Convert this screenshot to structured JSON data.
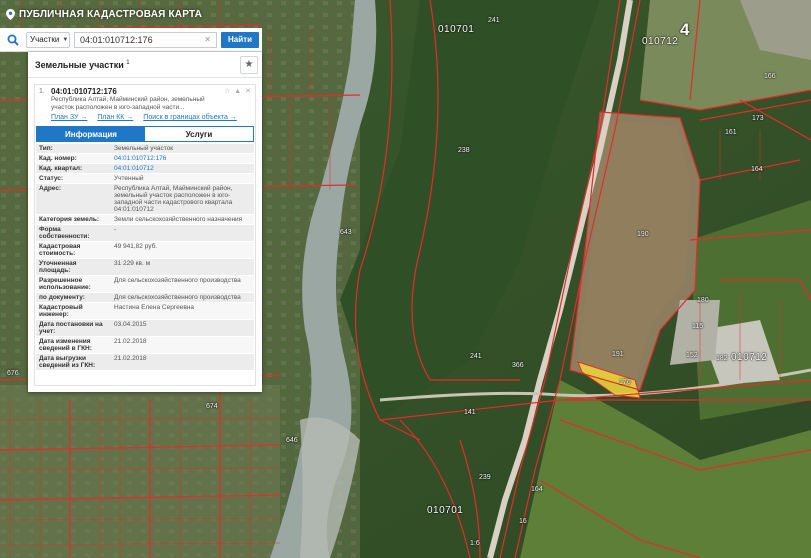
{
  "app": {
    "title": "ПУБЛИЧНАЯ КАДАСТРОВАЯ КАРТА"
  },
  "search": {
    "type": "Участки",
    "query": "04:01:010712:176",
    "clear": "✕",
    "button": "Найти"
  },
  "panel": {
    "title": "Земельные участки",
    "count": "1",
    "card": {
      "index": "1.",
      "cadastral_number": "04:01:010712:176",
      "description": "Республика Алтай, Майминский район, земельный участок расположен в юго-западной части...",
      "tools": "☆ ▲ ✕",
      "links": [
        "План ЗУ →",
        "План КК →",
        "Поиск в границах объекта →"
      ],
      "tabs": [
        "Информация",
        "Услуги"
      ],
      "rows": [
        {
          "key": "Тип:",
          "value": "Земельный участок"
        },
        {
          "key": "Кад. номер:",
          "value": "04:01:010712:176",
          "link": true
        },
        {
          "key": "Кад. квартал:",
          "value": "04:01:010712",
          "link": true
        },
        {
          "key": "Статус:",
          "value": "Учтенный"
        },
        {
          "key": "Адрес:",
          "value": "Республика Алтай, Майминский район, земельный участок расположен в юго-западной части кадастрового квартала 04:01:010712"
        },
        {
          "key": "Категория земель:",
          "value": "Земли сельскохозяйственного назначения"
        },
        {
          "key": "Форма собственности:",
          "value": "-"
        },
        {
          "key": "Кадастровая стоимость:",
          "value": "49 941,82 руб."
        },
        {
          "key": "Уточненная площадь:",
          "value": "31 229 кв. м"
        },
        {
          "key": "Разрешенное использование:",
          "value": "Для сельскохозяйственного производства"
        },
        {
          "key": "по документу:",
          "value": "Для сельскохозяйственного производства"
        },
        {
          "key": "Кадастровый инженер:",
          "value": "Настина Елена Сергеевна"
        },
        {
          "key": "Дата постановки на учет:",
          "value": "03.04.2015"
        },
        {
          "key": "Дата изменения сведений в ГКН:",
          "value": "21.02.2018"
        },
        {
          "key": "Дата выгрузки сведений из ГКН:",
          "value": "21.02.2018"
        }
      ]
    }
  },
  "map": {
    "labels": [
      "010701",
      "010712",
      "4",
      "010712",
      "010701",
      "241",
      "238",
      "176",
      "191",
      "190",
      "152",
      "180",
      "182",
      "166",
      "173",
      "161",
      "164",
      "676",
      "674",
      "646",
      "643",
      "241",
      "141",
      "239",
      "366",
      "164",
      "1:6",
      "115",
      "16"
    ],
    "colors": {
      "boundary": "#e52b2b",
      "selected": "#e8d23c",
      "river": "#9aa7a3",
      "field": "#8a7b5e"
    }
  }
}
